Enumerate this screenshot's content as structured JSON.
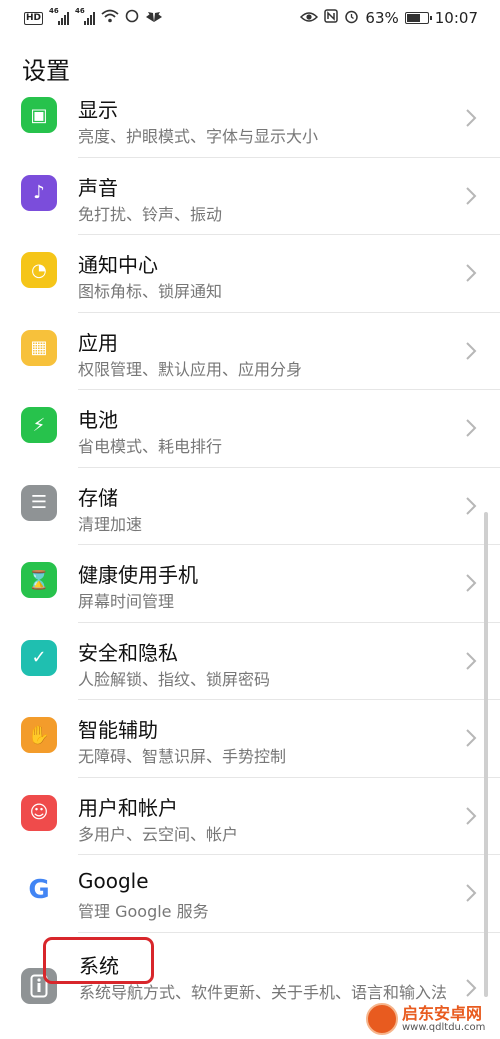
{
  "status_bar": {
    "hd": "HD",
    "signal1": "46",
    "signal2": "46",
    "battery": "63%",
    "time": "10:07"
  },
  "header": {
    "title": "设置"
  },
  "items": [
    {
      "title": "显示",
      "subtitle": "亮度、护眼模式、字体与显示大小",
      "icon": "display-icon",
      "color": "#27c24c",
      "glyph": "▣"
    },
    {
      "title": "声音",
      "subtitle": "免打扰、铃声、振动",
      "icon": "sound-icon",
      "color": "#7b4ddb",
      "glyph": "♪"
    },
    {
      "title": "通知中心",
      "subtitle": "图标角标、锁屏通知",
      "icon": "notification-icon",
      "color": "#f5c518",
      "glyph": "◔"
    },
    {
      "title": "应用",
      "subtitle": "权限管理、默认应用、应用分身",
      "icon": "apps-icon",
      "color": "#f7c13b",
      "glyph": "▦"
    },
    {
      "title": "电池",
      "subtitle": "省电模式、耗电排行",
      "icon": "battery-icon",
      "color": "#27c24c",
      "glyph": "⚡"
    },
    {
      "title": "存储",
      "subtitle": "清理加速",
      "icon": "storage-icon",
      "color": "#8f9395",
      "glyph": "☰"
    },
    {
      "title": "健康使用手机",
      "subtitle": "屏幕时间管理",
      "icon": "hourglass-icon",
      "color": "#27c24c",
      "glyph": "⌛"
    },
    {
      "title": "安全和隐私",
      "subtitle": "人脸解锁、指纹、锁屏密码",
      "icon": "security-icon",
      "color": "#1fbfb0",
      "glyph": "✓"
    },
    {
      "title": "智能辅助",
      "subtitle": "无障碍、智慧识屏、手势控制",
      "icon": "gesture-icon",
      "color": "#f39c2b",
      "glyph": "✋"
    },
    {
      "title": "用户和帐户",
      "subtitle": "多用户、云空间、帐户",
      "icon": "user-icon",
      "color": "#ef4b4b",
      "glyph": "☺"
    },
    {
      "title": "Google",
      "subtitle": "管理 Google 服务",
      "icon": "google-icon",
      "color": "#ffffff",
      "glyph": "G"
    }
  ],
  "system": {
    "title": "系统",
    "subtitle": "系统导航方式、软件更新、关于手机、语言和输入法",
    "icon": "system-info-icon",
    "color": "#8f9395",
    "highlight_color": "#d8262b"
  },
  "watermark": {
    "title": "启东安卓网",
    "url": "www.qdltdu.com"
  }
}
